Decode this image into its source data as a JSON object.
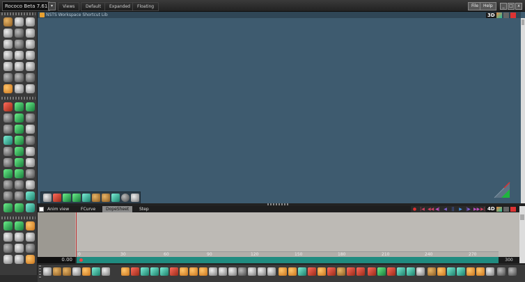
{
  "app": {
    "title": "Rococo Beta 7.61",
    "dropdown_glyph": "▾"
  },
  "top_tabs": [
    {
      "label": "Views"
    },
    {
      "label": "Default"
    },
    {
      "label": "Expanded"
    },
    {
      "label": "Floating"
    }
  ],
  "top_buttons": {
    "file": "File",
    "help": "Help"
  },
  "window_buttons": {
    "minimize": "_",
    "maximize": "□",
    "close": "x"
  },
  "viewport": {
    "title": "NSTS Workspace Shortcut Lib",
    "badge": "3D",
    "colors": {
      "background": "#3e5b6f",
      "header": "#2f4656"
    }
  },
  "anim_panel": {
    "tabs": [
      {
        "label": "Anim view"
      },
      {
        "label": "FCurve"
      },
      {
        "label": "DopeSheet",
        "active": true
      },
      {
        "label": "Step"
      }
    ],
    "badge": "4D",
    "playback_glyphs": [
      "●",
      "|◀",
      "◀◀",
      "◀|",
      "◀",
      "||",
      "▶",
      "|▶",
      "▶▶",
      "▶|"
    ],
    "frame_value": "0.00",
    "end_frame": "300",
    "ruler_ticks": [
      "0",
      "30",
      "60",
      "90",
      "120",
      "150",
      "180",
      "210",
      "240",
      "270"
    ],
    "colors": {
      "timebar": "#208c80",
      "current_frame_line": "#c03030",
      "body": "#bdbab5"
    }
  },
  "icons": {
    "left_toolbar": [
      "select-icon",
      "move-icon",
      "rotate-icon",
      "scale-icon",
      "brush-icon",
      "sphere-icon",
      "cube-icon",
      "cylinder-icon",
      "cone-icon",
      "torus-icon",
      "light-icon",
      "camera-icon"
    ],
    "viewport_toolbar": [
      "cursor-icon",
      "paint-icon",
      "green-cube-icon",
      "stairs-icon",
      "wave-icon",
      "box-icon",
      "grid-icon",
      "globe-icon",
      "tire-icon",
      "wand-icon"
    ],
    "bottom_toolbar": [
      "cursor-icon",
      "wand-icon",
      "box-icon",
      "transform-icon",
      "axis-icon",
      "magnet-icon",
      "mirror-icon",
      "align-icon",
      "hand-icon",
      "link-icon"
    ]
  }
}
